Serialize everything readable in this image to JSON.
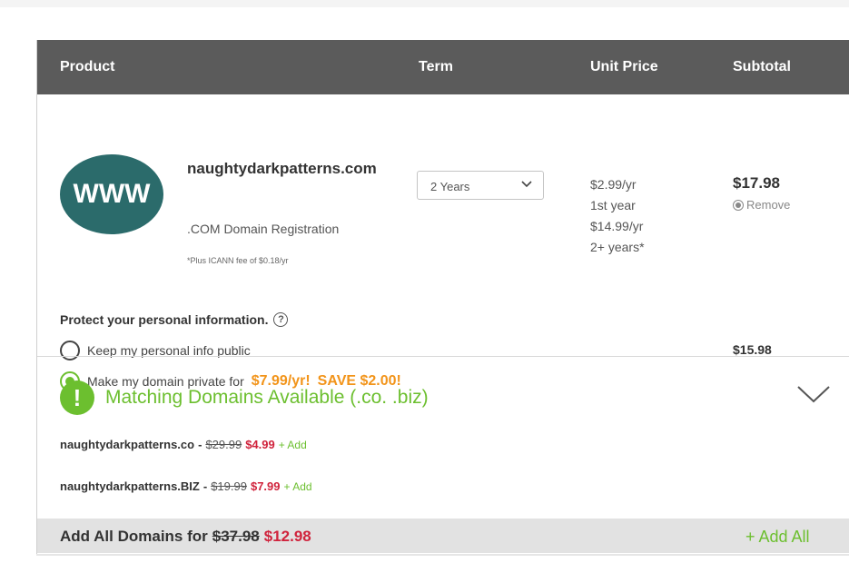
{
  "header": {
    "product": "Product",
    "term": "Term",
    "unit_price": "Unit Price",
    "subtotal": "Subtotal"
  },
  "product": {
    "logo_text": "WWW",
    "domain_name": "naughtydarkpatterns.com",
    "domain_type": ".COM Domain Registration",
    "icann_note": "*Plus ICANN fee of $0.18/yr",
    "term_value": "2 Years",
    "unit_price_line1": "$2.99/yr",
    "unit_price_line2": "1st year",
    "unit_price_line3": "$14.99/yr",
    "unit_price_line4": "2+ years*",
    "subtotal": "$17.98",
    "remove_label": "Remove"
  },
  "privacy": {
    "title": "Protect your personal information.",
    "help_glyph": "?",
    "option_public": "Keep my personal info public",
    "option_private_prefix": "Make my domain private for",
    "option_private_price": "$7.99/yr!",
    "option_private_save": "SAVE $2.00!",
    "selected": "private",
    "price": "$15.98"
  },
  "matching": {
    "alert_glyph": "!",
    "title": "Matching Domains Available (.co. .biz)",
    "offers": [
      {
        "domain": "naughtydarkpatterns.co",
        "sep": "-",
        "old_price": "$29.99",
        "new_price": "$4.99",
        "add_label": "+ Add"
      },
      {
        "domain": "naughtydarkpatterns.BIZ",
        "sep": "-",
        "old_price": "$19.99",
        "new_price": "$7.99",
        "add_label": "+ Add"
      }
    ]
  },
  "footer": {
    "label": "Add All Domains for",
    "old_price": "$37.98",
    "new_price": "$12.98",
    "add_all": "+ Add All"
  },
  "colors": {
    "header_bg": "#5b5b5b",
    "logo_teal": "#2b6b6b",
    "accent_green": "#6cbf2f",
    "accent_orange": "#f2941a",
    "price_red": "#d0233c",
    "footer_bg": "#e2e2e2"
  },
  "icons": {
    "term_dropdown": "chevron-down-icon",
    "remove": "remove-circle-icon",
    "help": "question-circle-icon",
    "alert": "exclamation-circle-icon",
    "expand": "chevron-down-icon"
  }
}
